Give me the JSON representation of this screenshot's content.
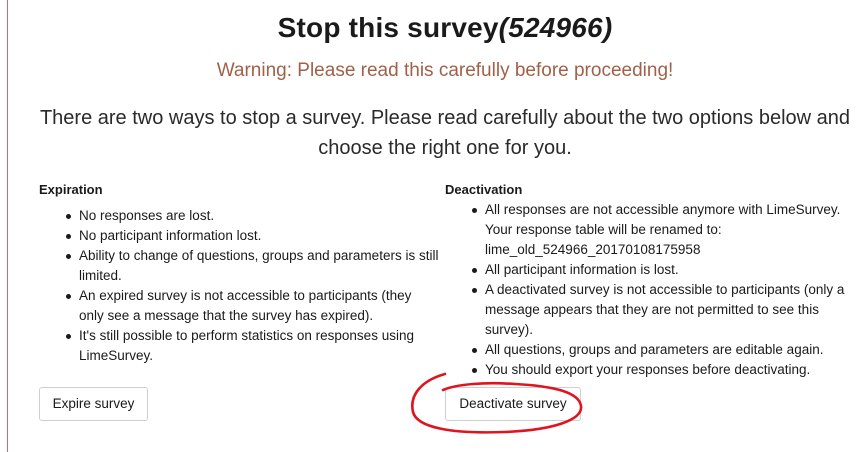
{
  "header": {
    "title": "Stop this survey",
    "survey_id": "(524966)",
    "warning": "Warning: Please read this carefully before proceeding!",
    "intro": "There are two ways to stop a survey. Please read carefully about the two options below and choose the right one for you."
  },
  "expiration": {
    "heading": "Expiration",
    "items": [
      "No responses are lost.",
      "No participant information lost.",
      "Ability to change of questions, groups and parameters is still limited.",
      "An expired survey is not accessible to participants (they only see a message that the survey has expired).",
      "It's still possible to perform statistics on responses using LimeSurvey."
    ],
    "button_label": "Expire survey"
  },
  "deactivation": {
    "heading": "Deactivation",
    "items": [
      "All responses are not accessible anymore with LimeSurvey. Your response table will be renamed to: lime_old_524966_20170108175958",
      "All participant information is lost.",
      "A deactivated survey is not accessible to participants (only a message appears that they are not permitted to see this survey).",
      "All questions, groups and parameters are editable again.",
      "You should export your responses before deactivating."
    ],
    "button_label": "Deactivate survey"
  },
  "colors": {
    "warning": "#a0614a",
    "annotation": "#e0141e",
    "left_rule": "#c8102e"
  }
}
